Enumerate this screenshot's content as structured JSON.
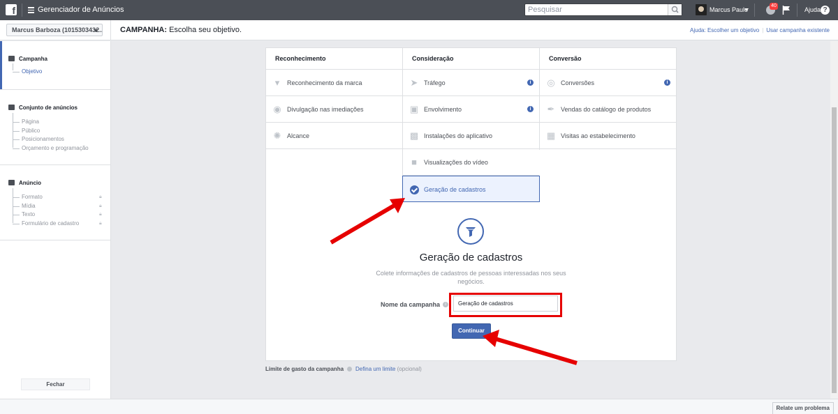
{
  "topbar": {
    "logo": "f",
    "app_title": "Gerenciador de Anúncios",
    "search_placeholder": "Pesquisar",
    "user_name": "Marcus Paulo",
    "notification_count": "40",
    "help_label": "Ajuda",
    "help_icon": "?"
  },
  "header": {
    "account": "Marcus Barboza (1015303432...",
    "crumb_bold": "CAMPANHA:",
    "crumb_text": " Escolha seu objetivo.",
    "link_help": "Ajuda: Escolher um objetivo",
    "link_existing": "Usar campanha existente"
  },
  "sidebar": {
    "campaign": {
      "title": "Campanha",
      "items": [
        "Objetivo"
      ]
    },
    "adset": {
      "title": "Conjunto de anúncios",
      "items": [
        "Página",
        "Público",
        "Posicionamentos",
        "Orçamento e programação"
      ]
    },
    "ad": {
      "title": "Anúncio",
      "items": [
        "Formato",
        "Mídia",
        "Texto",
        "Formulário de cadastro"
      ]
    },
    "close_label": "Fechar"
  },
  "objectives": {
    "columns": [
      "Reconhecimento",
      "Consideração",
      "Conversão"
    ],
    "col1": [
      "Reconhecimento da marca",
      "Divulgação nas imediações",
      "Alcance"
    ],
    "col2": [
      "Tráfego",
      "Envolvimento",
      "Instalações do aplicativo",
      "Visualizações do vídeo",
      "Geração de cadastros"
    ],
    "col3": [
      "Conversões",
      "Vendas do catálogo de produtos",
      "Visitas ao estabelecimento"
    ],
    "selected": "Geração de cadastros"
  },
  "detail": {
    "title": "Geração de cadastros",
    "description": "Colete informações de cadastros de pessoas interessadas nos seus negócios.",
    "name_label": "Nome da campanha",
    "name_value": "Geração de cadastros",
    "continue_label": "Continuar"
  },
  "limit": {
    "label": "Limite de gasto da campanha",
    "link": "Defina um limite",
    "optional": "(opcional)"
  },
  "footer": {
    "report_label": "Relate um problema"
  },
  "colors": {
    "topbar": "#4b4f56",
    "accent": "#4267b2",
    "annotation": "#e60000"
  }
}
